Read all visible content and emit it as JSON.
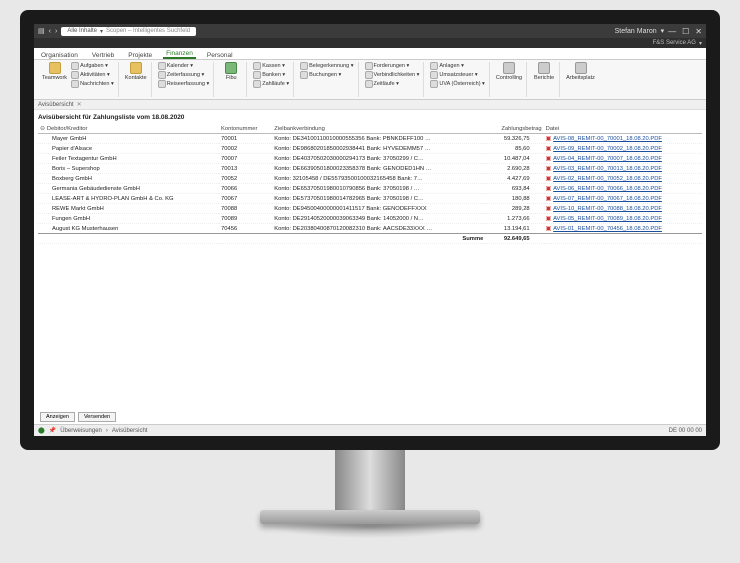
{
  "titlebar": {
    "search_scope": "Alle Inhalte",
    "search_placeholder": "Scopen – Intelligentes Suchfeld",
    "user": "Stefan Maron",
    "company": "F&S Service AG"
  },
  "menu": {
    "tabs": [
      "Organisation",
      "Vertrieb",
      "Projekte",
      "Finanzen",
      "Personal"
    ],
    "active": 3
  },
  "ribbon": {
    "group1_big": "Teamwork",
    "group1_list": [
      "Aufgaben",
      "Aktivitäten",
      "Nachrichten"
    ],
    "group2_big": "Kontakte",
    "group3_list": [
      "Kalender",
      "Zeiterfassung",
      "Reiseerfassung"
    ],
    "group4_big": "Fibu",
    "group5_list": [
      "Kassen",
      "Banken",
      "Zahlläufe"
    ],
    "group6_list": [
      "Belegerkennung",
      "Buchungen"
    ],
    "group7_list": [
      "Forderungen",
      "Verbindlichkeiten",
      "Zeitläufe"
    ],
    "group8_list_a": [
      "Anlagen",
      "Umsatzsteuer",
      "UVA (Österreich)"
    ],
    "group9_big": "Controlling",
    "group10_big": "Berichte",
    "group11_big": "Arbeitsplatz"
  },
  "breadcrumb": "Avisübersicht",
  "report": {
    "title": "Avisübersicht für Zahlungsliste vom 18.08.2020",
    "columns": [
      "Debitor/Kreditor",
      "Kontonummer",
      "Zielbankverbindung",
      "Zahlungsbetrag",
      "Datei"
    ],
    "rows": [
      {
        "name": "Mayer GmbH",
        "konto": "70001",
        "bank": "Konto: DE34100110010000555356 Bank: PBNKDEFF100 …",
        "betrag": "59.326,75",
        "file": "AVIS-08_REMIT-00_70001_18.08.20.PDF"
      },
      {
        "name": "Papier d'Alsace",
        "konto": "70002",
        "bank": "Konto: DE98680201850002938441 Bank: HYVEDEMM57 …",
        "betrag": "85,60",
        "file": "AVIS-09_REMIT-00_70002_18.08.20.PDF"
      },
      {
        "name": "Feiler Textagentur GmbH",
        "konto": "70007",
        "bank": "Konto: DE40370502030000294173 Bank: 37050299 / C…",
        "betrag": "10.487,04",
        "file": "AVIS-04_REMIT-00_70007_18.08.20.PDF"
      },
      {
        "name": "Boris – Supershop",
        "konto": "70013",
        "bank": "Konto: DE66390501800023358378 Bank: GENODED1HN …",
        "betrag": "2.690,28",
        "file": "AVIS-03_REMIT-00_70013_18.08.20.PDF"
      },
      {
        "name": "Boxberg GmbH",
        "konto": "70052",
        "bank": "Konto: 32105458 / DE55793500100032165458 Bank: 7…",
        "betrag": "4.427,69",
        "file": "AVIS-02_REMIT-00_70052_18.08.20.PDF"
      },
      {
        "name": "Germania Gebäudedienste GmbH",
        "konto": "70066",
        "bank": "Konto: DE65370501980010790856 Bank: 37050198 / …",
        "betrag": "693,84",
        "file": "AVIS-06_REMIT-00_70066_18.08.20.PDF"
      },
      {
        "name": "LEASE-ART & HYDRO-PLAN GmbH & Co. KG",
        "konto": "70067",
        "bank": "Konto: DE57370501980014782965 Bank: 37050198 / C…",
        "betrag": "180,88",
        "file": "AVIS-07_REMIT-00_70067_18.08.20.PDF"
      },
      {
        "name": "REWE Markt GmbH",
        "konto": "70088",
        "bank": "Konto: DE94500400000001411517 Bank: GENODEFFXXX",
        "betrag": "289,28",
        "file": "AVIS-10_REMIT-00_70088_18.08.20.PDF"
      },
      {
        "name": "Fungen GmbH",
        "konto": "70089",
        "bank": "Konto: DE29140520000039063349 Bank: 14052000 / N…",
        "betrag": "1.273,66",
        "file": "AVIS-05_REMIT-00_70089_18.08.20.PDF"
      },
      {
        "name": "August KG Musterhausen",
        "konto": "70456",
        "bank": "Konto: DE20380400870120082310 Bank: AACSDE33XXX …",
        "betrag": "13.194,61",
        "file": "AVIS-01_REMIT-00_70456_18.08.20.PDF"
      }
    ],
    "sum_label": "Summe",
    "sum_value": "92.649,65"
  },
  "footer": {
    "btn_anzeigen": "Anzeigen",
    "btn_versenden": "Versenden"
  },
  "status": {
    "crumb1": "Überweisungen",
    "crumb2": "Avisübersicht",
    "right": "DE 00 00 00"
  }
}
